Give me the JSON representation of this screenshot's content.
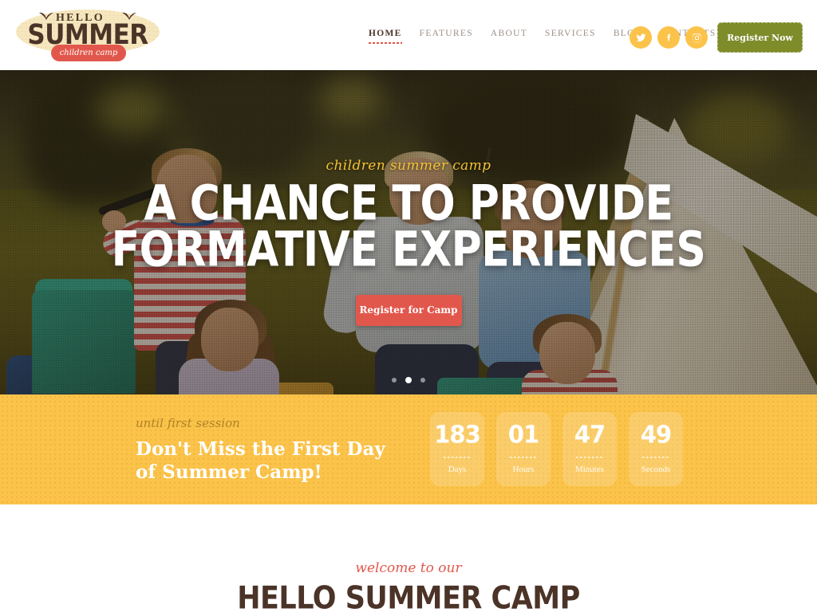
{
  "brand": {
    "hello": "HELLO",
    "summer": "SUMMER",
    "tagline": "children camp"
  },
  "nav": {
    "items": [
      {
        "label": "HOME",
        "active": true
      },
      {
        "label": "FEATURES",
        "active": false
      },
      {
        "label": "ABOUT",
        "active": false
      },
      {
        "label": "SERVICES",
        "active": false
      },
      {
        "label": "BLOG",
        "active": false
      },
      {
        "label": "CONTACTS",
        "active": false
      }
    ]
  },
  "social": [
    {
      "name": "twitter-icon"
    },
    {
      "name": "facebook-icon"
    },
    {
      "name": "instagram-icon"
    }
  ],
  "header": {
    "register_label": "Register Now"
  },
  "hero": {
    "kicker": "children summer camp",
    "title_line1": "A CHANCE TO PROVIDE",
    "title_line2": "FORMATIVE EXPERIENCES",
    "cta_label": "Register for Camp",
    "slide_count": 3,
    "active_slide": 2
  },
  "countdown": {
    "kicker": "until first session",
    "heading_line1": "Don't Miss the First Day",
    "heading_line2": "of Summer Camp!",
    "units": [
      {
        "value": "183",
        "label": "Days"
      },
      {
        "value": "01",
        "label": "Hours"
      },
      {
        "value": "47",
        "label": "Minutes"
      },
      {
        "value": "49",
        "label": "Seconds"
      }
    ]
  },
  "welcome": {
    "kicker": "welcome to our",
    "title": "HELLO SUMMER CAMP"
  },
  "colors": {
    "yellow": "#fbc34a",
    "red": "#e2574c",
    "olive": "#7f8c2a",
    "brown": "#4b3328",
    "cream": "#f6e6bd"
  }
}
